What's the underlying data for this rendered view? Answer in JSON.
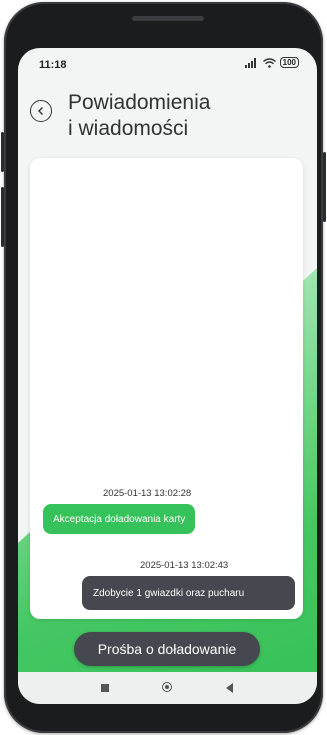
{
  "status_bar": {
    "time": "11:18",
    "signal_icon": "signal-icon",
    "wifi_icon": "wifi-icon",
    "battery": "100"
  },
  "header": {
    "back_icon": "back-arrow-icon",
    "title_line1": "Powiadomienia",
    "title_line2": "i wiadomości"
  },
  "messages": [
    {
      "timestamp": "2025-01-13 13:02:28",
      "text": "Akceptacja doładowania karty",
      "color": "#36c25a"
    },
    {
      "timestamp": "2025-01-13 13:02:43",
      "text": "Zdobycie 1 gwiazdki oraz pucharu",
      "color": "#45494f"
    }
  ],
  "request_button": {
    "label": "Prośba o doładowanie"
  },
  "nav_bar": {
    "recent_icon": "recent-apps-icon",
    "home_icon": "home-icon",
    "back_icon": "nav-back-icon"
  },
  "colors": {
    "accent_green": "#36c25a",
    "dark_bubble": "#45494f",
    "phone_frame": "#1b1c1e"
  }
}
